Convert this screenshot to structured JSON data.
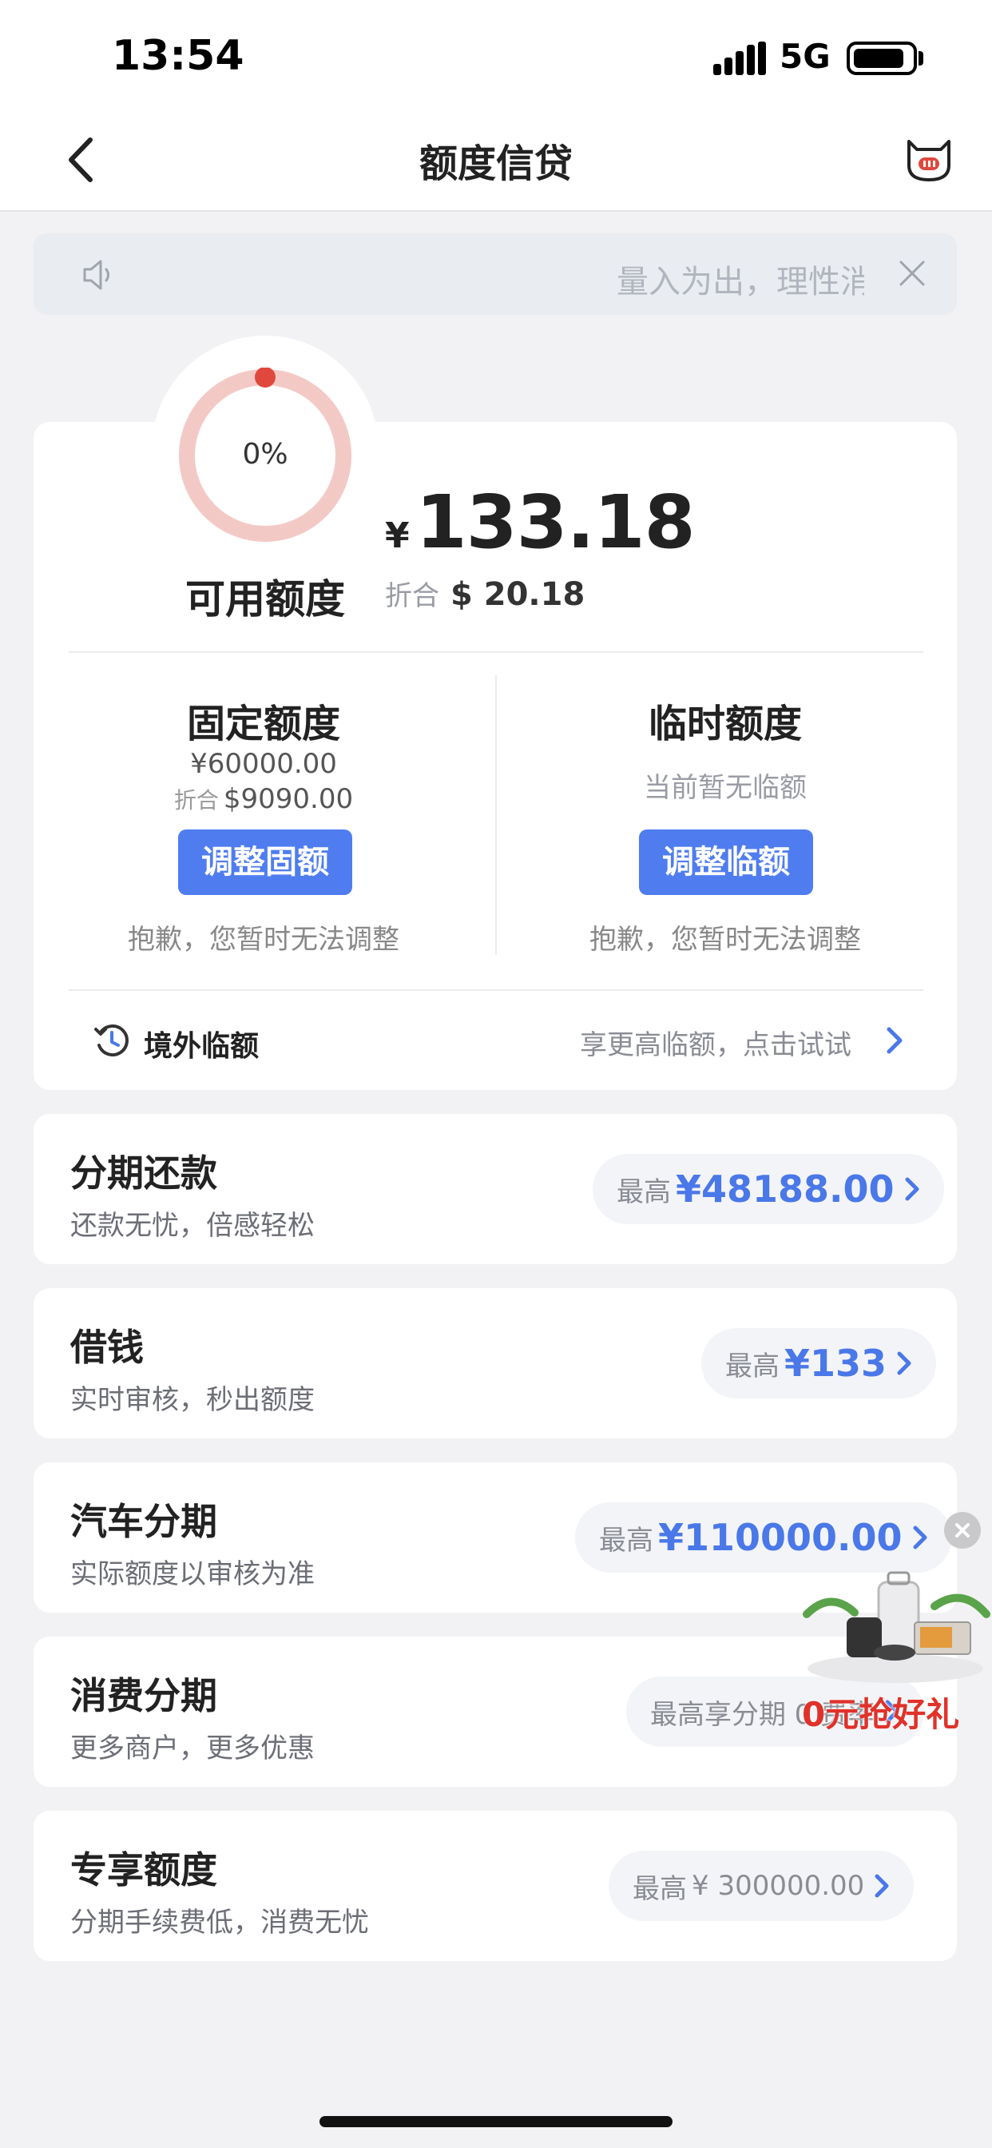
{
  "status_bar": {
    "time": "13:54",
    "network": "5G"
  },
  "nav": {
    "title": "额度信贷"
  },
  "notice": {
    "text": "量入为出，理性消费"
  },
  "credit": {
    "ring_percent": "0%",
    "available_label": "可用额度",
    "currency_symbol": "¥",
    "available_amount": "133.18",
    "usd_prefix": "折合",
    "usd_value": "$ 20.18"
  },
  "fixed": {
    "title": "固定额度",
    "amount": "¥60000.00",
    "usd_prefix": "折合",
    "usd_value": "$9090.00",
    "button": "调整固额",
    "note": "抱歉，您暂时无法调整"
  },
  "temporary": {
    "title": "临时额度",
    "status": "当前暂无临额",
    "button": "调整临额",
    "note": "抱歉，您暂时无法调整"
  },
  "overseas": {
    "label": "境外临额",
    "promo": "享更高临额，点击试试"
  },
  "products": [
    {
      "title": "分期还款",
      "subtitle": "还款无忧，倍感轻松",
      "max_label": "最高",
      "max_value": "¥48188.00"
    },
    {
      "title": "借钱",
      "subtitle": "实时审核，秒出额度",
      "max_label": "最高",
      "max_value": "¥133"
    },
    {
      "title": "汽车分期",
      "subtitle": "实际额度以审核为准",
      "max_label": "最高",
      "max_value": "¥110000.00"
    },
    {
      "title": "消费分期",
      "subtitle": "更多商户，更多优惠",
      "max_label": "最高享分期 0 费率"
    },
    {
      "title": "专享额度",
      "subtitle": "分期手续费低，消费无忧",
      "max_label": "最高",
      "max_value": "¥ 300000.00"
    }
  ],
  "promo": {
    "text": "0元抢好礼"
  },
  "colors": {
    "accent": "#4f7df0",
    "ring": "#f3c9c6",
    "ring_dot": "#e0483e",
    "promo": "#e0322a"
  }
}
